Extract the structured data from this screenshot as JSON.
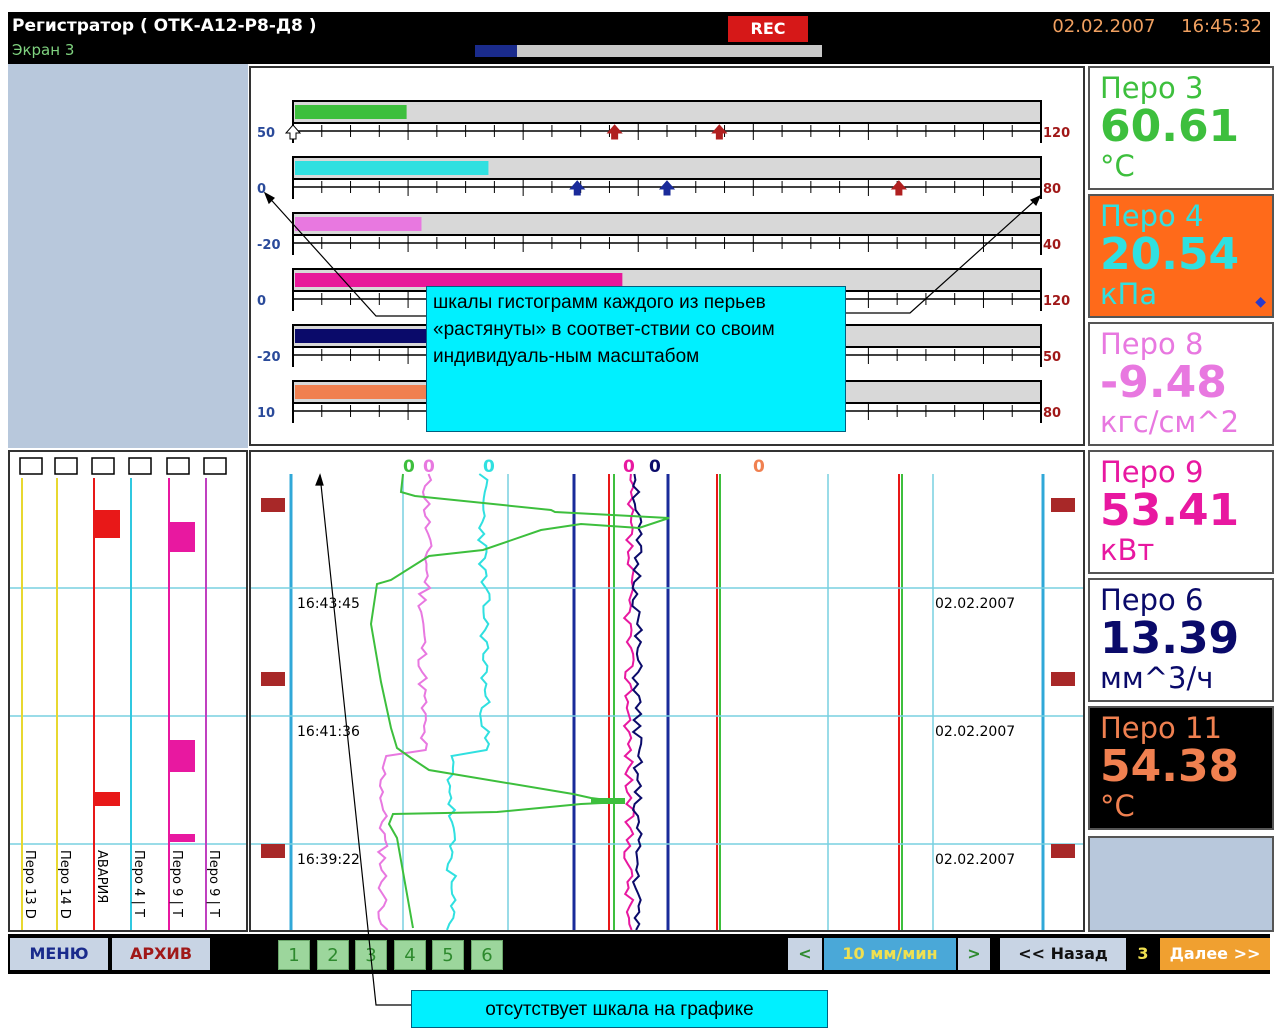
{
  "header": {
    "title": "Регистратор ( ОТК-А12-Р8-Д8 )",
    "screen_name": "Экран 3",
    "rec_label": "REC",
    "progress": 0.12,
    "date": "02.02.2007",
    "time": "16:45:32"
  },
  "bar_graphs": [
    {
      "color": "#3dbf3d",
      "fill": 0.15,
      "scale_min": "50",
      "scale_max": "120",
      "min_color": "#2a4a9a",
      "max_color": "#a01818",
      "markers": [
        {
          "pos": 0.0,
          "color": "#ffffff"
        },
        {
          "pos": 0.43,
          "color": "#b02020"
        },
        {
          "pos": 0.57,
          "color": "#b02020"
        }
      ]
    },
    {
      "color": "#30e0e0",
      "fill": 0.26,
      "scale_min": "0",
      "scale_max": "80",
      "min_color": "#2a4a9a",
      "max_color": "#a01818",
      "markers": [
        {
          "pos": 0.38,
          "color": "#1a2b9a"
        },
        {
          "pos": 0.5,
          "color": "#1a2b9a"
        },
        {
          "pos": 0.81,
          "color": "#b02020"
        }
      ]
    },
    {
      "color": "#e878e0",
      "fill": 0.17,
      "scale_min": "-20",
      "scale_max": "40",
      "min_color": "#2a4a9a",
      "max_color": "#a01818",
      "markers": []
    },
    {
      "color": "#e8189a",
      "fill": 0.44,
      "scale_min": "0",
      "scale_max": "120",
      "min_color": "#2a4a9a",
      "max_color": "#a01818",
      "markers": []
    },
    {
      "color": "#0a0a6a",
      "fill": 0.2,
      "scale_min": "-20",
      "scale_max": "50",
      "min_color": "#2a4a9a",
      "max_color": "#a01818",
      "markers": []
    },
    {
      "color": "#f08050",
      "fill": 0.2,
      "scale_min": "10",
      "scale_max": "80",
      "min_color": "#2a4a9a",
      "max_color": "#a01818",
      "markers": []
    }
  ],
  "event_channels": [
    {
      "label": "Перо 13 D",
      "color": "#e8d830"
    },
    {
      "label": "Перо 14 D",
      "color": "#e8d830"
    },
    {
      "label": "АВАРИЯ",
      "color": "#e81818"
    },
    {
      "label": "Перо 4 | Т",
      "color": "#30c8e0"
    },
    {
      "label": "Перо 9 | Т",
      "color": "#e818a0"
    },
    {
      "label": "Перо 9 | Т",
      "color": "#c040c0"
    }
  ],
  "trend": {
    "timestamps": [
      "16:43:45",
      "16:41:36",
      "16:39:22"
    ],
    "date_labels": [
      "02.02.2007",
      "02.02.2007",
      "02.02.2007"
    ],
    "zero_labels": [
      {
        "text": "0",
        "color": "#3dbf3d"
      },
      {
        "text": "0",
        "color": "#e878e0"
      },
      {
        "text": "0",
        "color": "#30e0e0"
      },
      {
        "text": "0",
        "color": "#e818a0"
      },
      {
        "text": "0",
        "color": "#0a0a6a"
      },
      {
        "text": "0",
        "color": "#f08050"
      }
    ]
  },
  "pens": [
    {
      "name": "Перо 3",
      "value": "60.61",
      "unit": "°C",
      "name_color": "#3dbf3d",
      "value_color": "#3dbf3d",
      "bg": "#ffffff"
    },
    {
      "name": "Перо 4",
      "value": "20.54",
      "unit": "кПа",
      "name_color": "#30e0e0",
      "value_color": "#30e0e0",
      "bg": "#ff6a1a",
      "alarm": "◆"
    },
    {
      "name": "Перо 8",
      "value": "-9.48",
      "unit": "кгс/см^2",
      "name_color": "#e878e0",
      "value_color": "#e878e0",
      "bg": "#ffffff"
    },
    {
      "name": "Перо 9",
      "value": "53.41",
      "unit": "кВт",
      "name_color": "#e818a0",
      "value_color": "#e818a0",
      "bg": "#ffffff"
    },
    {
      "name": "Перо 6",
      "value": "13.39",
      "unit": "мм^3/ч",
      "name_color": "#0a0a6a",
      "value_color": "#0a0a6a",
      "bg": "#ffffff"
    },
    {
      "name": "Перо 11",
      "value": "54.38",
      "unit": "°C",
      "name_color": "#f08050",
      "value_color": "#f08050",
      "bg": "#000000"
    }
  ],
  "footer": {
    "menu_label": "МЕНЮ",
    "archive_label": "АРХИВ",
    "screens": [
      "1",
      "2",
      "3",
      "4",
      "5",
      "6"
    ],
    "speed_left": "<",
    "speed_value": "10 мм/мин",
    "speed_right": ">",
    "back_label": "<< Назад",
    "page_number": "3",
    "next_label": "Далее >>"
  },
  "callouts": {
    "scales_text": "шкалы гистограмм каждого из перьев «растянуты» в соответ-ствии со своим индивидуаль-ным масштабом",
    "noscale_text": "отсутствует шкала на графике"
  }
}
